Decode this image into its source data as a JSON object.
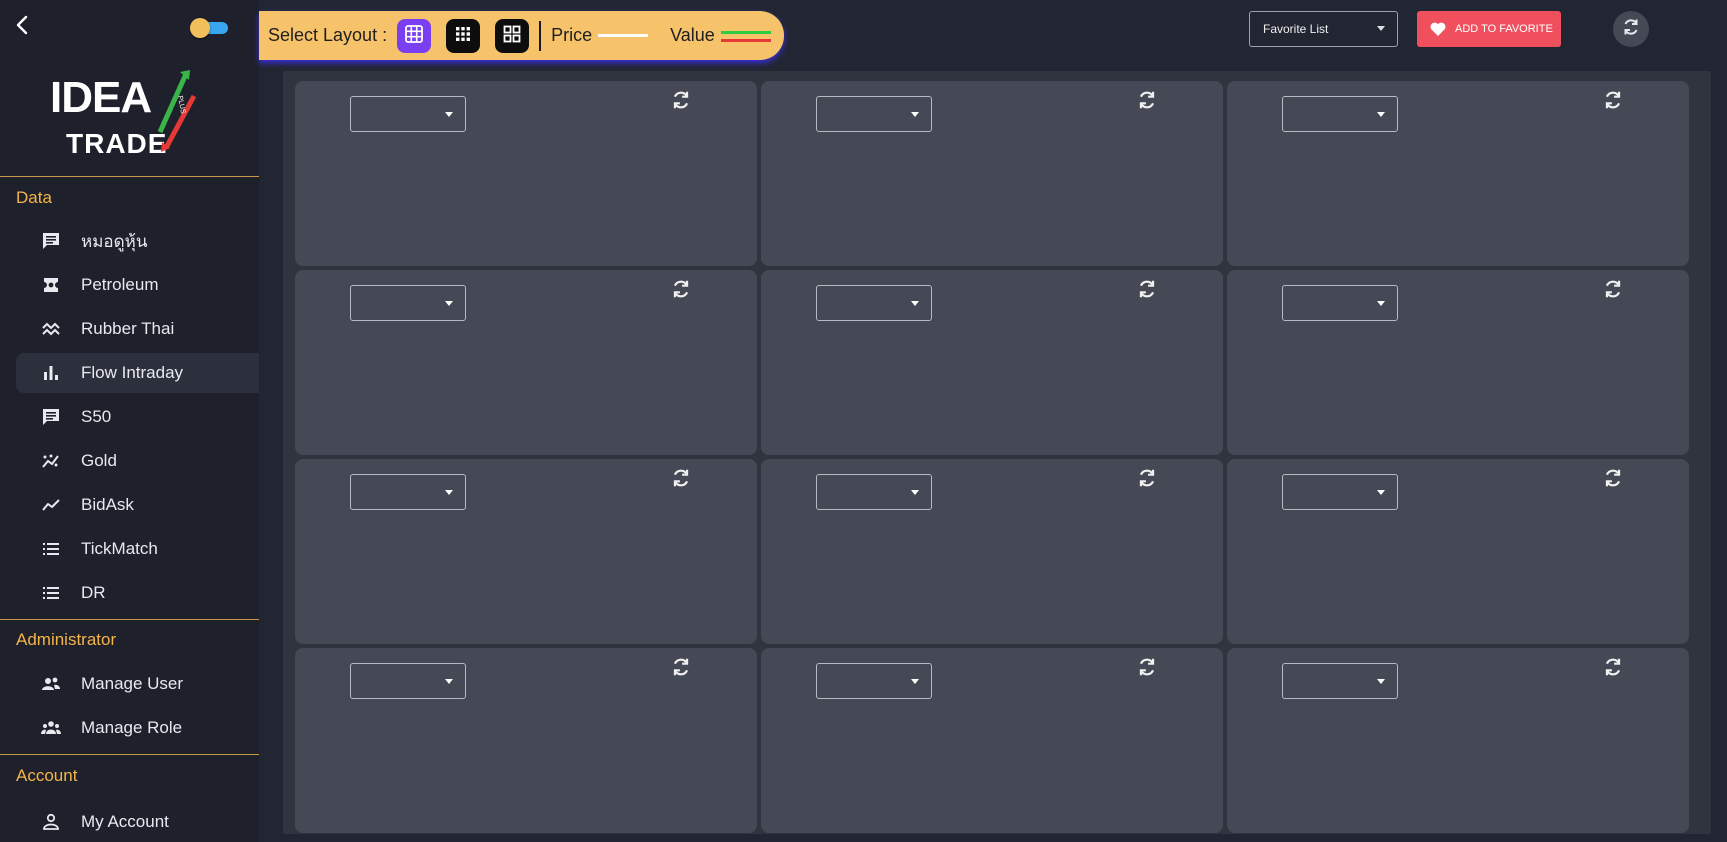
{
  "sidebar": {
    "logo": {
      "line1": "IDEA",
      "line2": "TRADE",
      "badge": "PLUS"
    },
    "sections": [
      {
        "title": "Data",
        "items": [
          {
            "label": "หมอดูหุ้น",
            "icon": "message-icon"
          },
          {
            "label": "Petroleum",
            "icon": "fuel-icon"
          },
          {
            "label": "Rubber Thai",
            "icon": "wave-icon"
          },
          {
            "label": "Flow Intraday",
            "icon": "bar-chart-icon",
            "active": true
          },
          {
            "label": "S50",
            "icon": "message-icon"
          },
          {
            "label": "Gold",
            "icon": "scatter-line-icon"
          },
          {
            "label": "BidAsk",
            "icon": "trend-line-icon"
          },
          {
            "label": "TickMatch",
            "icon": "list-icon"
          },
          {
            "label": "DR",
            "icon": "list-icon"
          }
        ]
      },
      {
        "title": "Administrator",
        "items": [
          {
            "label": "Manage User",
            "icon": "users-icon"
          },
          {
            "label": "Manage Role",
            "icon": "group-icon"
          }
        ]
      },
      {
        "title": "Account",
        "items": [
          {
            "label": "My Account",
            "icon": "person-icon"
          }
        ]
      }
    ]
  },
  "topbar": {
    "select_layout_label": "Select Layout :",
    "price_label": "Price",
    "value_label": "Value",
    "favorite_select": "Favorite List",
    "add_favorite_label": "ADD TO FAVORITE"
  },
  "colors": {
    "accent": "#f5b44a",
    "layout_active": "#7a3ff0",
    "add_favorite": "#f0505e",
    "price_line": "#ffffff",
    "value_line_top": "#2ecc40",
    "value_line_bottom": "#e53935"
  },
  "grid": {
    "rows": 4,
    "columns": 3
  }
}
